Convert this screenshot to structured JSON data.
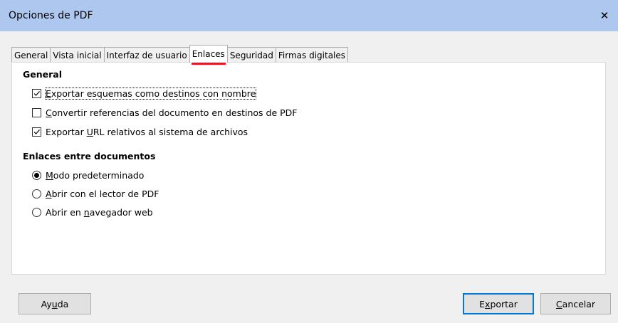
{
  "window": {
    "title": "Opciones de PDF",
    "close_glyph": "✕"
  },
  "tabs": [
    {
      "label": "General",
      "active": false
    },
    {
      "label": "Vista inicial",
      "active": false
    },
    {
      "label": "Interfaz de usuario",
      "active": false
    },
    {
      "label": "Enlaces",
      "active": true
    },
    {
      "label": "Seguridad",
      "active": false
    },
    {
      "label": "Firmas digitales",
      "active": false
    }
  ],
  "general": {
    "title": "General",
    "options": [
      {
        "pre": "",
        "key": "E",
        "post": "xportar esquemas como destinos con nombre",
        "checked": true
      },
      {
        "pre": "",
        "key": "C",
        "post": "onvertir referencias del documento en destinos de PDF",
        "checked": false
      },
      {
        "pre": "Exportar ",
        "key": "U",
        "post": "RL relativos al sistema de archivos",
        "checked": true
      }
    ]
  },
  "cross_doc": {
    "title": "Enlaces entre documentos",
    "options": [
      {
        "pre": "",
        "key": "M",
        "post": "odo predeterminado",
        "selected": true
      },
      {
        "pre": "",
        "key": "A",
        "post": "brir con el lector de PDF",
        "selected": false
      },
      {
        "pre": "Abrir en ",
        "key": "n",
        "post": "avegador web",
        "selected": false
      }
    ]
  },
  "buttons": {
    "help": {
      "pre": "Ay",
      "key": "u",
      "post": "da"
    },
    "export": {
      "pre": "E",
      "key": "x",
      "post": "portar"
    },
    "cancel": {
      "pre": "",
      "key": "C",
      "post": "ancelar"
    }
  },
  "colors": {
    "titlebar": "#aec7ee",
    "active_tab_underline": "#e01b24",
    "default_button_border": "#0078d7"
  }
}
